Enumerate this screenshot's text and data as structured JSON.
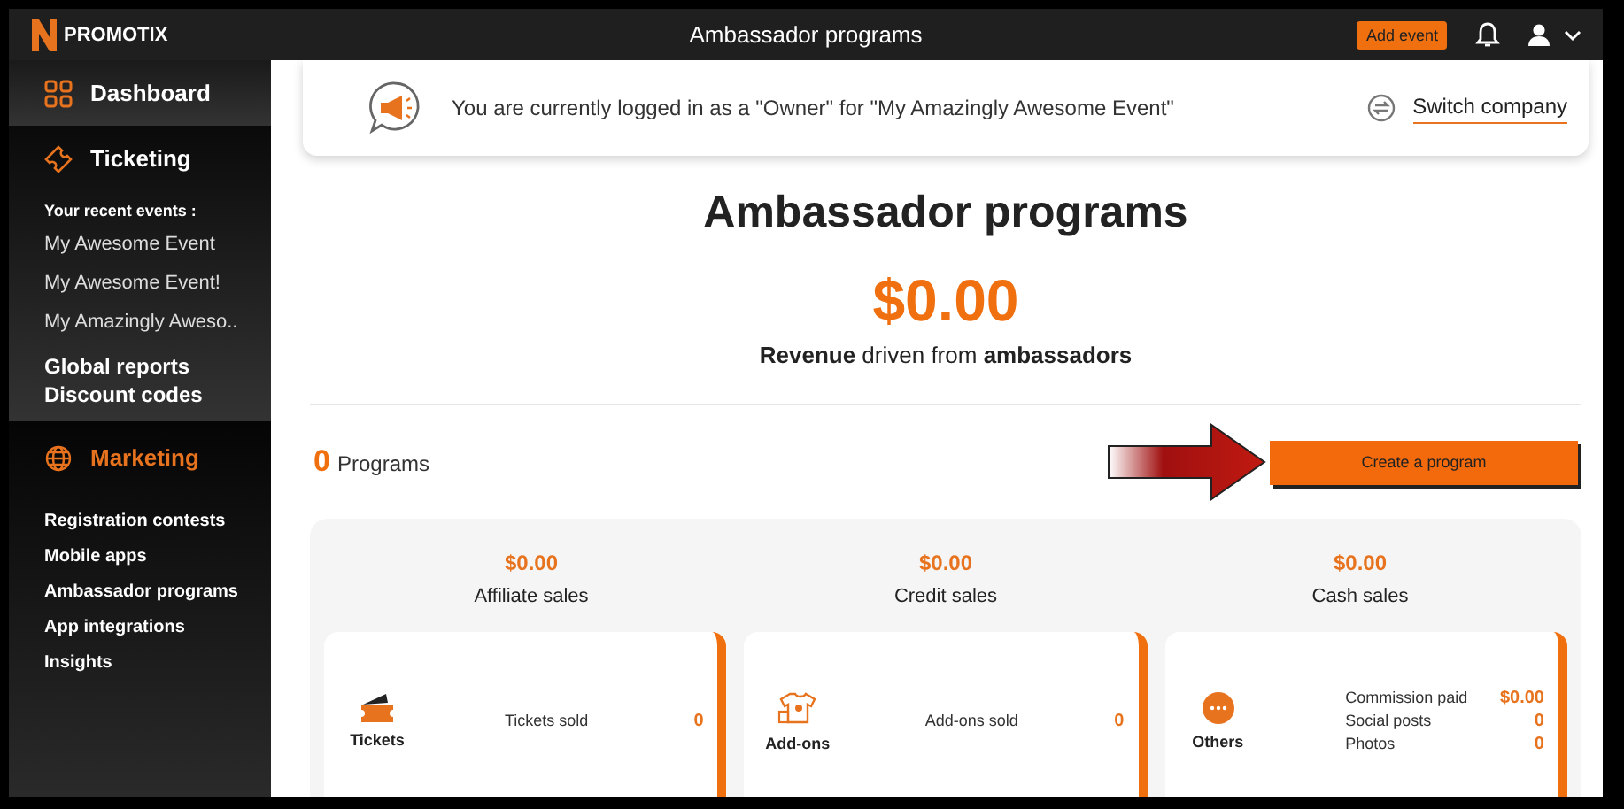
{
  "header": {
    "logo": "PROMOTIX",
    "title": "Ambassador programs",
    "add_event": "Add event"
  },
  "sidebar": {
    "sections": [
      {
        "label": "Dashboard",
        "kind": "dashboard",
        "selected": false
      },
      {
        "label": "Ticketing",
        "kind": "ticket",
        "selected": false,
        "recent_label": "Your recent events :",
        "recent": [
          "My Awesome Event",
          "My Awesome Event!",
          "My Amazingly Aweso.."
        ],
        "links": [
          "Global reports",
          "Discount codes"
        ]
      },
      {
        "label": "Marketing",
        "kind": "globe",
        "selected": true,
        "items": [
          "Registration contests",
          "Mobile apps",
          "Ambassador programs",
          "App integrations",
          "Insights"
        ]
      }
    ]
  },
  "notice": {
    "text": "You are currently logged in as a \"Owner\" for \"My Amazingly Awesome Event\"",
    "switch": "Switch company"
  },
  "title": "Ambassador programs",
  "revenue": {
    "amount": "$0.00",
    "caption": "**Revenue** driven from **ambassadors**"
  },
  "programs": {
    "count": "0",
    "label": "Programs",
    "create": "Create a program"
  },
  "stats": [
    {
      "amount": "$0.00",
      "label": "Affiliate sales"
    },
    {
      "amount": "$0.00",
      "label": "Credit sales"
    },
    {
      "amount": "$0.00",
      "label": "Cash sales"
    }
  ],
  "cards": [
    {
      "kind": "tickets",
      "name": "Tickets",
      "rows": [
        {
          "label": "Tickets sold",
          "value": "0"
        }
      ]
    },
    {
      "kind": "addons",
      "name": "Add-ons",
      "rows": [
        {
          "label": "Add-ons sold",
          "value": "0"
        }
      ]
    },
    {
      "kind": "others",
      "name": "Others",
      "rows": [
        {
          "label": "Commission paid",
          "value": "$0.00"
        },
        {
          "label": "Social posts",
          "value": "0"
        },
        {
          "label": "Photos",
          "value": "0"
        }
      ]
    }
  ]
}
